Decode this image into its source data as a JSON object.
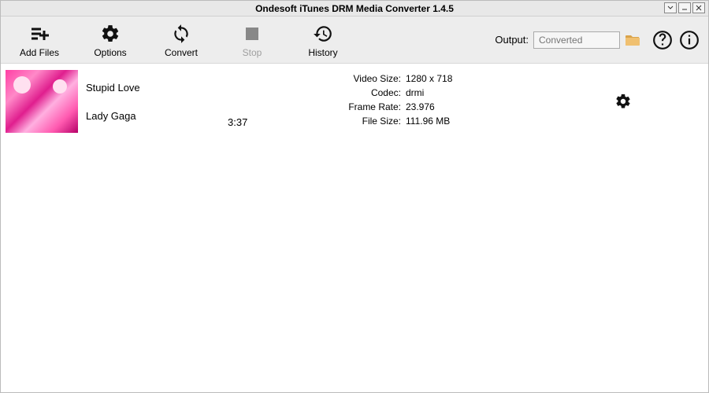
{
  "window": {
    "title": "Ondesoft iTunes DRM Media Converter 1.4.5"
  },
  "toolbar": {
    "add_files": "Add Files",
    "options": "Options",
    "convert": "Convert",
    "stop": "Stop",
    "history": "History"
  },
  "output": {
    "label": "Output:",
    "placeholder": "Converted"
  },
  "item": {
    "title": "Stupid Love",
    "artist": "Lady Gaga",
    "duration": "3:37",
    "props": {
      "video_size_label": "Video Size:",
      "video_size": "1280 x 718",
      "codec_label": "Codec:",
      "codec": "drmi",
      "frame_rate_label": "Frame Rate:",
      "frame_rate": "23.976",
      "file_size_label": "File Size:",
      "file_size": "111.96 MB"
    }
  }
}
